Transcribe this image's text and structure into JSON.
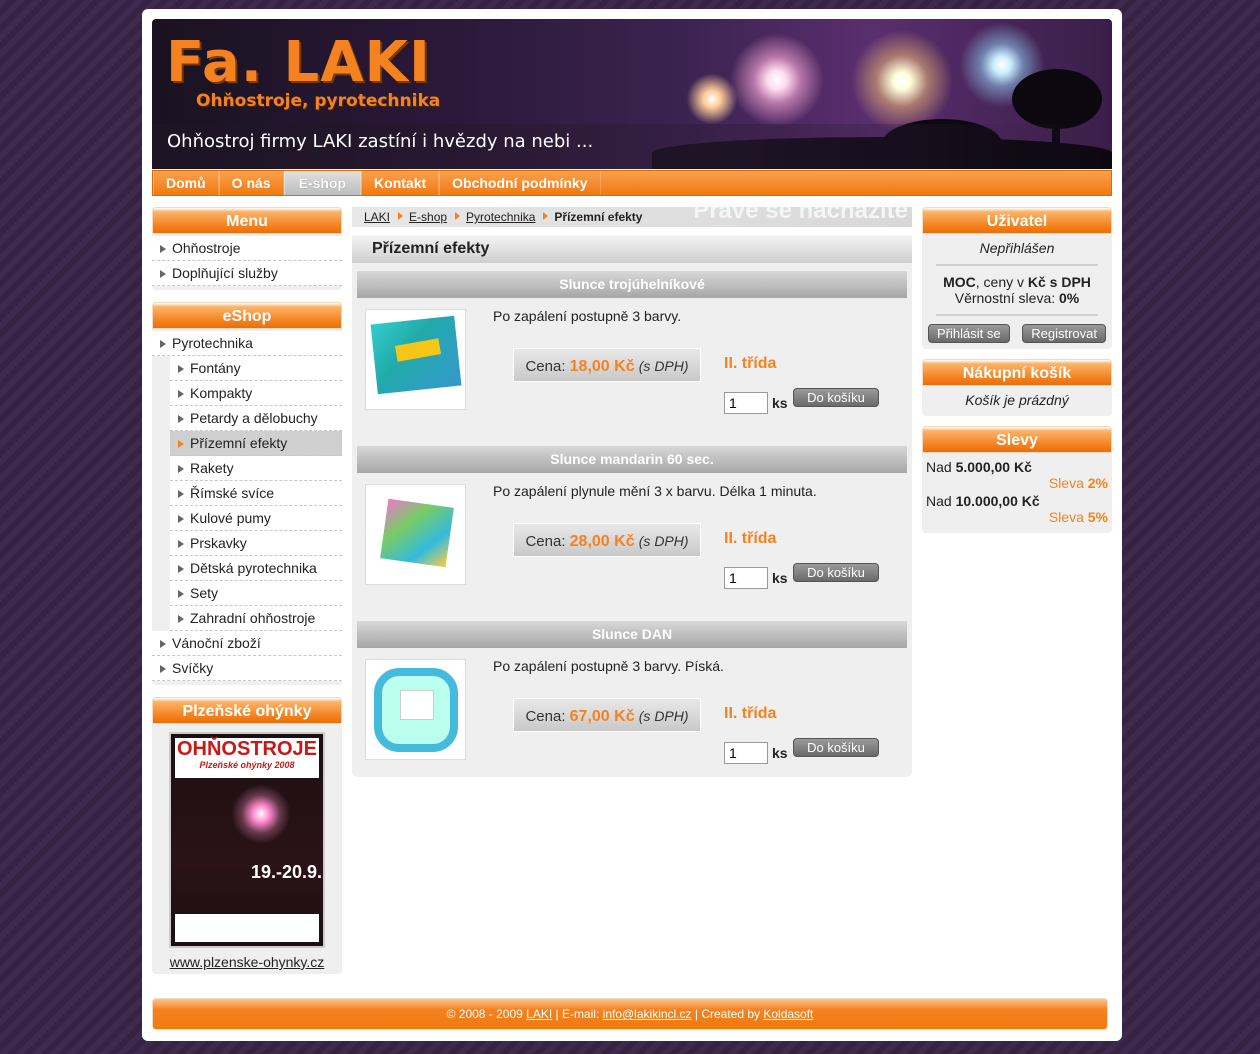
{
  "banner": {
    "logo": "Fa. LAKI",
    "sublogo": "Ohňostroje, pyrotechnika",
    "slogan": "Ohňostroj firmy LAKI zastíní i hvězdy na nebi ..."
  },
  "nav": [
    "Domů",
    "O nás",
    "E-shop",
    "Kontakt",
    "Obchodní podmínky"
  ],
  "menu": {
    "title": "Menu",
    "items": [
      "Ohňostroje",
      "Doplňující služby"
    ]
  },
  "eshop": {
    "title": "eShop",
    "top": "Pyrotechnika",
    "sub": [
      "Fontány",
      "Kompakty",
      "Petardy a dělobuchy",
      "Přízemní efekty",
      "Rakety",
      "Římské svíce",
      "Kulové pumy",
      "Prskavky",
      "Dětská pyrotechnika",
      "Sety",
      "Zahradní ohňostroje"
    ],
    "bottom": [
      "Vánoční zboží",
      "Svíčky"
    ]
  },
  "plzen": {
    "title": "Plzeňské ohýnky",
    "poster_title": "OHŇOSTROJE",
    "poster_sub": "Plzeňské ohýnky 2008",
    "poster_date": "19.-20.9.",
    "link": "www.plzenske-ohynky.cz"
  },
  "breadcrumb": {
    "items": [
      "LAKI",
      "E-shop",
      "Pyrotechnika"
    ],
    "current": "Přízemní efekty",
    "ghost": "Právě se nacházíte"
  },
  "center_title": "Přízemní efekty",
  "products": [
    {
      "name": "Slunce trojúhelníkové",
      "desc": "Po zapálení postupně 3 barvy.",
      "price_label": "Cena:",
      "price": "18,00 Kč",
      "vat": "(s DPH)",
      "class": "II. třída",
      "qty": "1",
      "unit": "ks",
      "button": "Do košíku"
    },
    {
      "name": "Slunce mandarin 60 sec.",
      "desc": "Po zapálení plynule mění 3 x barvu. Délka 1 minuta.",
      "price_label": "Cena:",
      "price": "28,00 Kč",
      "vat": "(s DPH)",
      "class": "II. třída",
      "qty": "1",
      "unit": "ks",
      "button": "Do košíku"
    },
    {
      "name": "Slunce DAN",
      "desc": "Po zapálení postupně 3 barvy. Píská.",
      "price_label": "Cena:",
      "price": "67,00 Kč",
      "vat": "(s DPH)",
      "class": "II. třída",
      "qty": "1",
      "unit": "ks",
      "button": "Do košíku"
    }
  ],
  "user": {
    "title": "Uživatel",
    "status": "Nepřihlášen",
    "moc": "MOC",
    "price_text": ", ceny v ",
    "price_unit": "Kč s DPH",
    "loyalty_label": "Věrnostní sleva: ",
    "loyalty_value": "0%",
    "login": "Přihlásit se",
    "register": "Registrovat"
  },
  "cart": {
    "title": "Nákupní košík",
    "status": "Košík je prázdný"
  },
  "discounts": {
    "title": "Slevy",
    "rows": [
      {
        "label": "Nad ",
        "amount": "5.000,00 Kč",
        "sleva": "Sleva ",
        "pct": "2%"
      },
      {
        "label": "Nad ",
        "amount": "10.000,00 Kč",
        "sleva": "Sleva ",
        "pct": "5%"
      }
    ]
  },
  "footer": {
    "copyright": "© 2008 - 2009 ",
    "laki": "LAKI",
    "email_label": " | E-mail: ",
    "email": "info@lakikincl.cz",
    "created_label": " | Created by ",
    "creator": "Koldasoft"
  },
  "colors": {
    "accent": "#f58220",
    "bg": "#3a2648",
    "panel": "#efefef"
  }
}
